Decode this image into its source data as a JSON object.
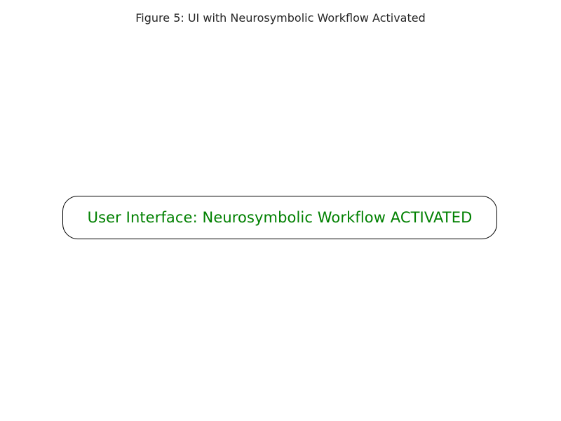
{
  "figure": {
    "title": "Figure 5: UI with Neurosymbolic Workflow Activated"
  },
  "status_box": {
    "text": "User Interface: Neurosymbolic Workflow ACTIVATED",
    "text_color": "#008000",
    "border_color": "#000000"
  }
}
